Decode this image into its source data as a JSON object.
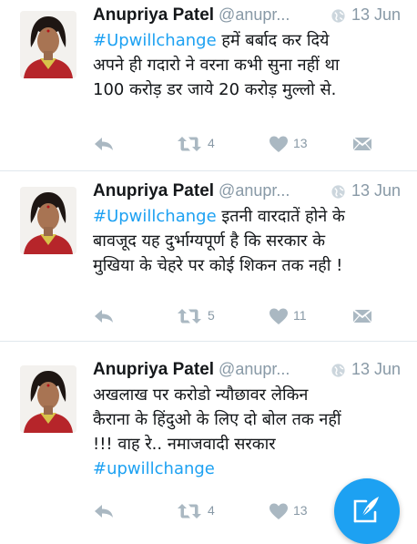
{
  "tweets": [
    {
      "name": "Anupriya Patel",
      "handle": "@anupr...",
      "date": "13 Jun",
      "hashtag": "#Upwillchange",
      "line1_rest": " हमें बर्बाद कर दिये",
      "line2": "अपने ही गदारो ने वरना कभी सुना नहीं था",
      "line3": "100 करोड़ डर जाये 20 करोड़ मुल्लो से.",
      "retweets": "4",
      "likes": "13"
    },
    {
      "name": "Anupriya Patel",
      "handle": "@anupr...",
      "date": "13 Jun",
      "hashtag": "#Upwillchange",
      "line1_rest": " इतनी वारदातें होने के",
      "line2": "बावजूद यह दुर्भाग्यपूर्ण है कि सरकार के",
      "line3": "मुखिया के चेहरे पर कोई शिकन तक नही !",
      "retweets": "5",
      "likes": "11"
    },
    {
      "name": "Anupriya Patel",
      "handle": "@anupr...",
      "date": "13 Jun",
      "line1": "अखलाख पर करोडो न्यौछावर लेकिन",
      "line2": "कैराना के हिंदुओ के लिए दो बोल तक नहीं",
      "line3": "!!!  वाह रे.. नमाजवादी सरकार",
      "hashtag": "#upwillchange",
      "retweets": "4",
      "likes": "13"
    }
  ],
  "icons": {
    "reply": "reply-icon",
    "retweet": "retweet-icon",
    "like": "heart-icon",
    "dm": "direct-message-icon",
    "globe": "globe-icon",
    "compose": "compose-tweet-icon"
  },
  "colors": {
    "link": "#1da1f2",
    "muted": "#8899a6",
    "action_icon": "#aab8c2",
    "fab": "#1da1f2"
  }
}
